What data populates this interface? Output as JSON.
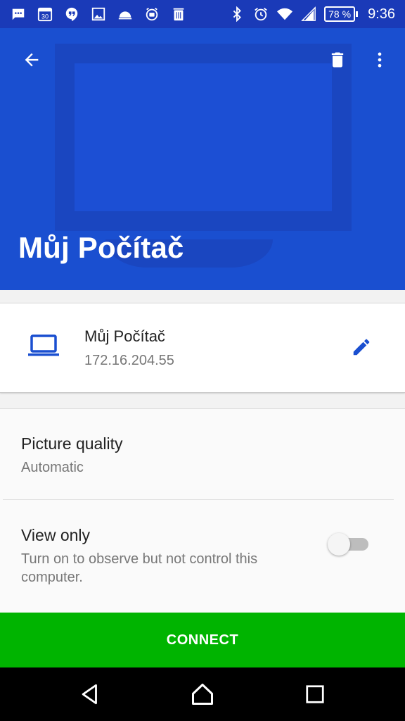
{
  "status_bar": {
    "battery_label": "78 %",
    "time": "9:36",
    "calendar_day": "30",
    "icons": [
      "message-icon",
      "calendar-icon",
      "hangouts-icon",
      "image-icon",
      "cloud-icon",
      "alarm-robot-icon",
      "trash-app-icon",
      "bluetooth-icon",
      "alarm-icon",
      "wifi-icon",
      "signal-icon",
      "battery-icon"
    ]
  },
  "header": {
    "title": "Můj Počítač",
    "color": "#1a4fd0",
    "icons": [
      "back-arrow-icon",
      "delete-icon",
      "more-vert-icon"
    ]
  },
  "host": {
    "name": "Můj Počítač",
    "address": "172.16.204.55",
    "icon": "laptop-icon",
    "edit_icon": "pencil-icon",
    "accent": "#1a4fd0"
  },
  "settings": {
    "quality": {
      "title": "Picture quality",
      "value": "Automatic"
    },
    "view_only": {
      "title": "View only",
      "description": "Turn on to observe but not control this computer.",
      "enabled": false
    }
  },
  "connect": {
    "label": "CONNECT",
    "color": "#00b400"
  },
  "nav": {
    "icons": [
      "nav-back-icon",
      "nav-home-icon",
      "nav-recents-icon"
    ]
  }
}
